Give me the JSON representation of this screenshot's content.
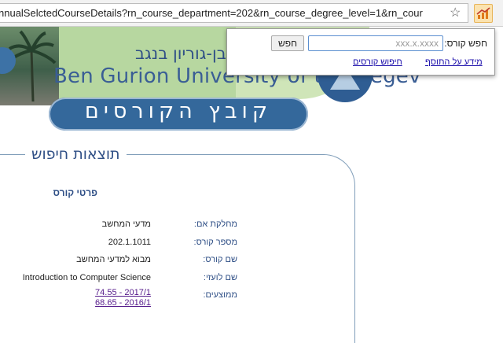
{
  "browser": {
    "url": "nnualSelctedCourseDetails?rn_course_department=202&rn_course_degree_level=1&rn_cour",
    "bookmark_icon": "star-icon",
    "extension_icon": "chart-icon"
  },
  "banner": {
    "university_hebrew": "בן-גוריון בנגב",
    "university_english": "Ben Gurion University of the Negev",
    "title": "קובץ הקורסים"
  },
  "results": {
    "section_title": "תוצאות חיפוש",
    "course_header": "פרטי קורס",
    "rows": [
      {
        "label": "מחלקת אם:",
        "value": "מדעי המחשב"
      },
      {
        "label": "מספר קורס:",
        "value": "202.1.1011"
      },
      {
        "label": "שם קורס:",
        "value": "מבוא למדעי המחשב"
      },
      {
        "label": "שם לועזי:",
        "value": "Introduction to Computer Science"
      }
    ],
    "averages_label": "ממוצעים:",
    "averages": [
      "74.55 - 2017/1",
      "68.65 - 2016/1"
    ]
  },
  "popup": {
    "search_label": "חפש קורס:",
    "input_value": "",
    "input_placeholder": "xxx.x.xxxx",
    "search_button": "חפש",
    "link_about": "מידע על התוסף",
    "link_search": "חיפוש קורסים"
  },
  "colors": {
    "brand_blue": "#2f4f86",
    "banner_green": "#b7d7a0",
    "pill_blue": "#34689b"
  }
}
